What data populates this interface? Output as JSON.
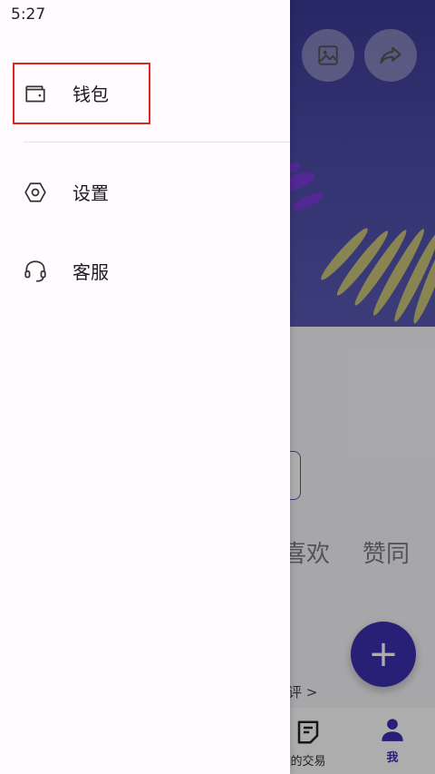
{
  "status_bar": {
    "time": "5:27"
  },
  "drawer": {
    "items": [
      {
        "label": "钱包",
        "icon": "wallet-icon"
      },
      {
        "label": "设置",
        "icon": "settings-hex-icon"
      },
      {
        "label": "客服",
        "icon": "headset-icon"
      }
    ]
  },
  "background": {
    "tabs": {
      "like": "喜欢",
      "agree": "赞同"
    },
    "review_link": "评 >",
    "fab_label": "+",
    "bottom_nav": {
      "trade": "的交易",
      "me": "我"
    },
    "colors": {
      "accent": "#3b2fb0",
      "hero": "#4c4ba8",
      "highlight": "#e0231f"
    }
  }
}
